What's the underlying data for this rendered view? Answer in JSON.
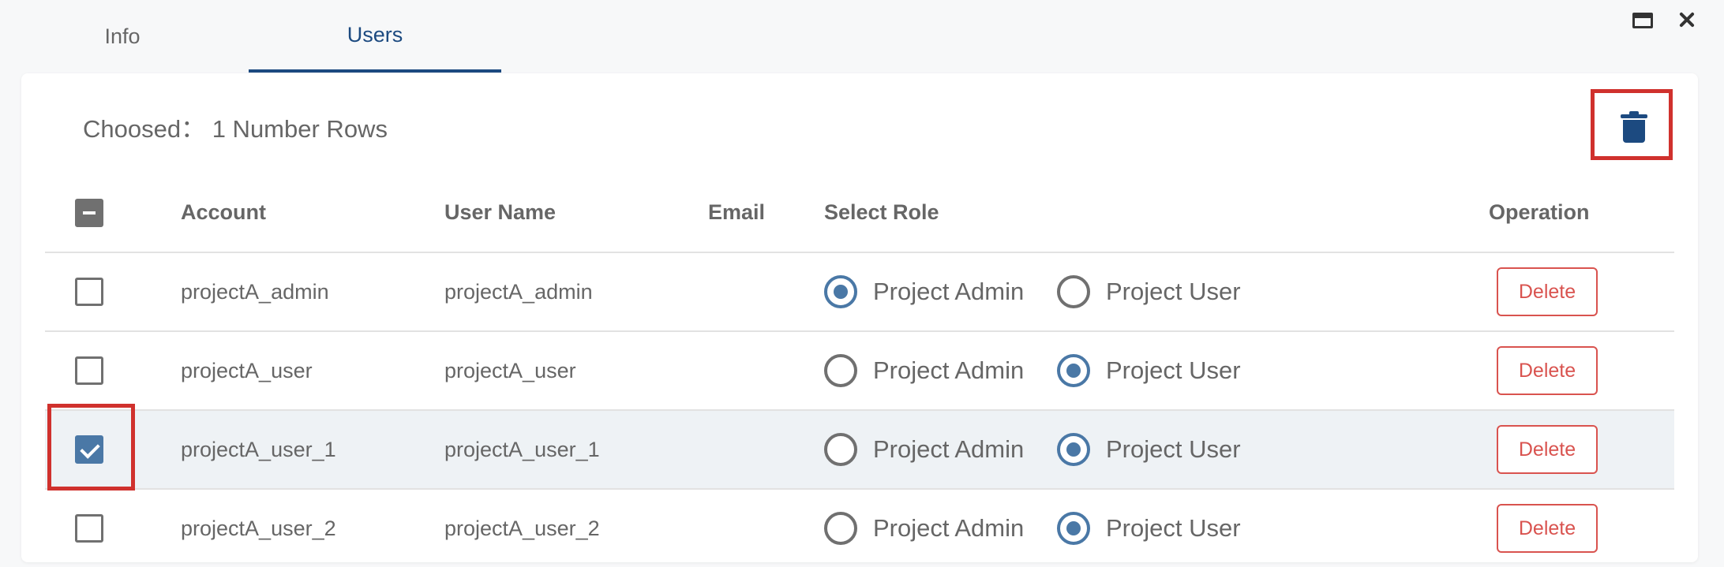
{
  "tabs": [
    {
      "label": "Info",
      "active": false
    },
    {
      "label": "Users",
      "active": true
    }
  ],
  "window": {
    "maximize_icon": "maximize-icon",
    "close_icon": "close-icon"
  },
  "selection": {
    "text": "Choosed： 1 Number Rows"
  },
  "toolbar": {
    "delete_icon": "trash-icon"
  },
  "table": {
    "columns": {
      "account": "Account",
      "user_name": "User Name",
      "email": "Email",
      "select_role": "Select Role",
      "operation": "Operation"
    },
    "header_checkbox_state": "indeterminate",
    "rows": [
      {
        "account": "projectA_admin",
        "user_name": "projectA_admin",
        "email": "",
        "role": "Project Admin",
        "checked": false,
        "role_admin": "Project Admin",
        "role_user": "Project User",
        "delete": "Delete"
      },
      {
        "account": "projectA_user",
        "user_name": "projectA_user",
        "email": "",
        "role": "Project User",
        "checked": false,
        "role_admin": "Project Admin",
        "role_user": "Project User",
        "delete": "Delete"
      },
      {
        "account": "projectA_user_1",
        "user_name": "projectA_user_1",
        "email": "",
        "role": "Project User",
        "checked": true,
        "role_admin": "Project Admin",
        "role_user": "Project User",
        "delete": "Delete"
      },
      {
        "account": "projectA_user_2",
        "user_name": "projectA_user_2",
        "email": "",
        "role": "Project User",
        "checked": false,
        "role_admin": "Project Admin",
        "role_user": "Project User",
        "delete": "Delete"
      }
    ]
  },
  "colors": {
    "accent": "#1c4a80",
    "radio_active": "#4a78a6",
    "danger": "#d9534f",
    "highlight": "#d0312d",
    "selected_row": "#eef2f5"
  }
}
